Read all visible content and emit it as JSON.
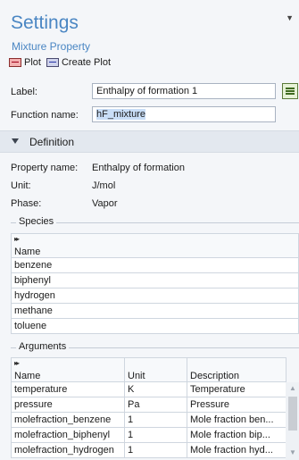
{
  "header": {
    "title": "Settings",
    "subtitle": "Mixture Property",
    "menu_icon": "dropdown-arrow-icon"
  },
  "toolbar": {
    "plot_label": "Plot",
    "create_plot_label": "Create Plot"
  },
  "form": {
    "label_label": "Label:",
    "label_value": "Enthalpy of formation 1",
    "function_name_label": "Function name:",
    "function_name_value": "hF_mixture"
  },
  "definition": {
    "section_title": "Definition",
    "property_name_label": "Property name:",
    "property_name_value": "Enthalpy of formation",
    "unit_label": "Unit:",
    "unit_value": "J/mol",
    "phase_label": "Phase:",
    "phase_value": "Vapor"
  },
  "species": {
    "group_title": "Species",
    "column_header": "Name",
    "rows": [
      "benzene",
      "biphenyl",
      "hydrogen",
      "methane",
      "toluene"
    ]
  },
  "arguments": {
    "group_title": "Arguments",
    "columns": [
      "Name",
      "Unit",
      "Description"
    ],
    "rows": [
      [
        "temperature",
        "K",
        "Temperature"
      ],
      [
        "pressure",
        "Pa",
        "Pressure"
      ],
      [
        "molefraction_benzene",
        "1",
        "Mole fraction ben..."
      ],
      [
        "molefraction_biphenyl",
        "1",
        "Mole fraction bip..."
      ],
      [
        "molefraction_hydrogen",
        "1",
        "Mole fraction hyd..."
      ]
    ]
  }
}
